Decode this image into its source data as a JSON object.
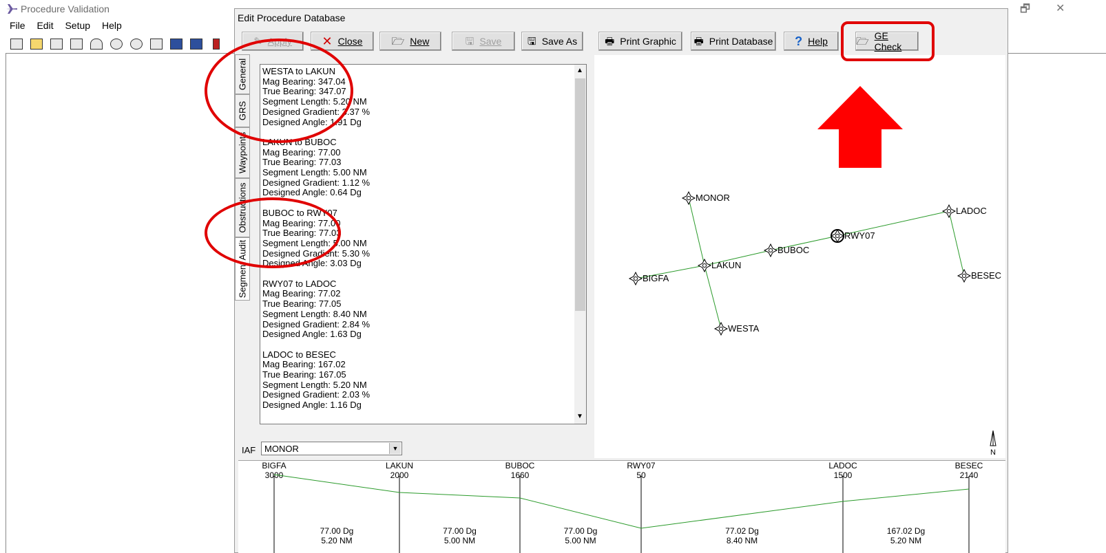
{
  "app": {
    "title": "Procedure Validation",
    "restore_glyph": "🗗",
    "close_glyph": "✕",
    "menu": [
      "File",
      "Edit",
      "Setup",
      "Help"
    ],
    "toolbar_icons": [
      "new-icon",
      "open-icon",
      "print-icon",
      "preview-icon",
      "chart-icon",
      "zoom-in-icon",
      "zoom-out-icon",
      "zoom-fit-icon",
      "window-icon",
      "list-icon",
      "exit-icon"
    ]
  },
  "dialog": {
    "title": "Edit Procedure Database",
    "buttons": {
      "apply": "Apply",
      "close": "Close",
      "new": "New",
      "save": "Save",
      "save_as": "Save As",
      "print_graphic": "Print Graphic",
      "print_database": "Print Database",
      "help": "Help",
      "ge_check": "GE Check"
    },
    "tabs": [
      "General",
      "GRS",
      "Waypoints",
      "Obstructions",
      "Segment Audit"
    ],
    "active_tab": "Segment Audit",
    "segments": [
      {
        "title": "WESTA to LAKUN",
        "lines": [
          "Mag Bearing: 347.04",
          "True Bearing: 347.07",
          "Segment Length: 5.20 NM",
          "Designed Gradient: 3.37 %",
          "Designed Angle: 1.91 Dg"
        ]
      },
      {
        "title": "LAKUN to BUBOC",
        "lines": [
          "Mag Bearing: 77.00",
          "True Bearing: 77.03",
          "Segment Length: 5.00 NM",
          "Designed Gradient: 1.12 %",
          "Designed Angle: 0.64 Dg"
        ]
      },
      {
        "title": "BUBOC to RWY07",
        "lines": [
          "Mag Bearing: 77.00",
          "True Bearing: 77.03",
          "Segment Length: 5.00 NM",
          "Designed Gradient: 5.30 %",
          "Designed Angle: 3.03 Dg"
        ]
      },
      {
        "title": "RWY07 to LADOC",
        "lines": [
          "Mag Bearing: 77.02",
          "True Bearing: 77.05",
          "Segment Length: 8.40 NM",
          "Designed Gradient: 2.84 %",
          "Designed Angle: 1.63 Dg"
        ]
      },
      {
        "title": "LADOC to BESEC",
        "lines": [
          "Mag Bearing: 167.02",
          "True Bearing: 167.05",
          "Segment Length: 5.20 NM",
          "Designed Gradient: 2.03 %",
          "Designed Angle: 1.16 Dg"
        ]
      }
    ],
    "iaf": {
      "label": "IAF",
      "value": "MONOR"
    },
    "map": {
      "waypoints": [
        "MONOR",
        "LAKUN",
        "BUBOC",
        "RWY07",
        "LADOC",
        "BESEC",
        "BIGFA",
        "WESTA"
      ],
      "north_label": "N"
    },
    "profile": {
      "points": [
        {
          "name": "BIGFA",
          "altitude": "3000"
        },
        {
          "name": "LAKUN",
          "altitude": "2000"
        },
        {
          "name": "BUBOC",
          "altitude": "1660"
        },
        {
          "name": "RWY07",
          "altitude": "50"
        },
        {
          "name": "LADOC",
          "altitude": "1500"
        },
        {
          "name": "BESEC",
          "altitude": "2140"
        }
      ],
      "legs": [
        {
          "bearing": "77.00 Dg",
          "length": "5.20 NM"
        },
        {
          "bearing": "77.00 Dg",
          "length": "5.00 NM"
        },
        {
          "bearing": "77.00 Dg",
          "length": "5.00 NM"
        },
        {
          "bearing": "77.02 Dg",
          "length": "8.40 NM"
        },
        {
          "bearing": "167.02 Dg",
          "length": "5.20 NM"
        }
      ]
    }
  },
  "colors": {
    "annotation": "#e00000",
    "track": "#2a9a2a"
  }
}
